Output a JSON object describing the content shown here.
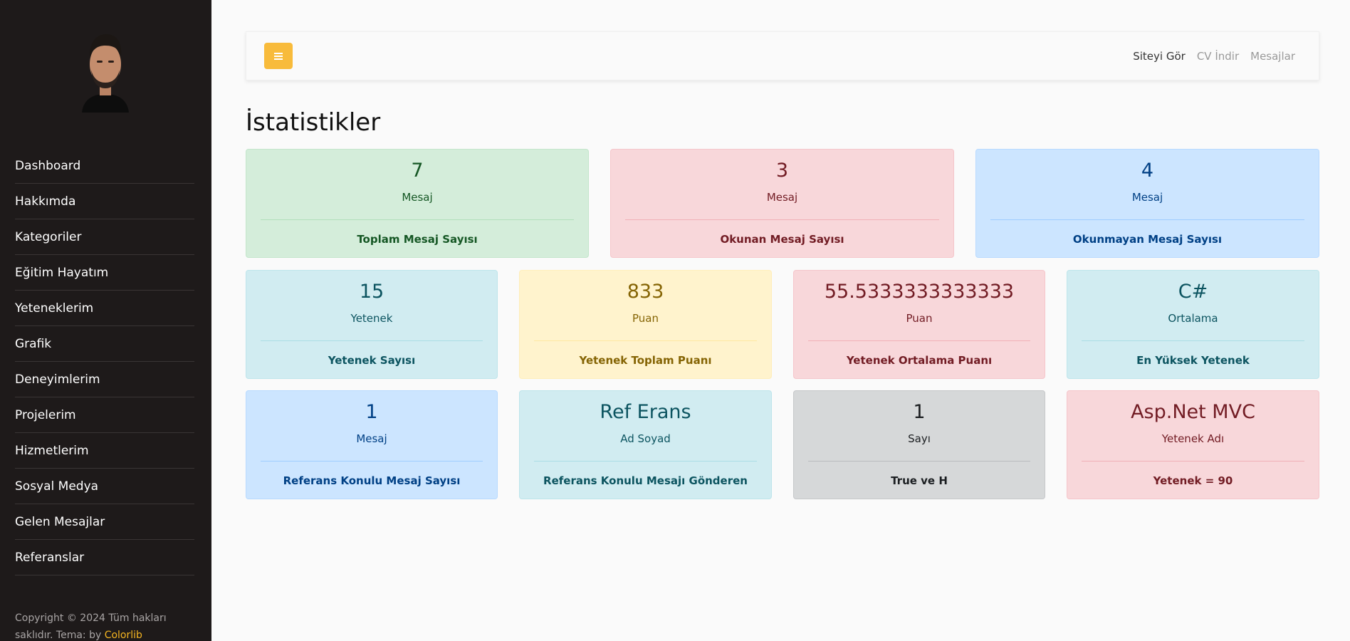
{
  "sidebar": {
    "items": [
      {
        "label": "Dashboard"
      },
      {
        "label": "Hakkımda"
      },
      {
        "label": "Kategoriler"
      },
      {
        "label": "Eğitim Hayatım"
      },
      {
        "label": "Yeteneklerim"
      },
      {
        "label": "Grafik"
      },
      {
        "label": "Deneyimlerim"
      },
      {
        "label": "Projelerim"
      },
      {
        "label": "Hizmetlerim"
      },
      {
        "label": "Sosyal Medya"
      },
      {
        "label": "Gelen Mesajlar"
      },
      {
        "label": "Referanslar"
      }
    ],
    "footer": {
      "text": "Copyright © 2024 Tüm hakları saklıdır. Tema: by",
      "link": "Colorlib"
    }
  },
  "topbar": {
    "links": [
      "Siteyi Gör",
      "CV İndir",
      "Mesajlar"
    ],
    "toggle_icon": "menu-icon",
    "toggle_color": "#f8bb3b"
  },
  "page": {
    "title": "İstatistikler"
  },
  "cards": [
    {
      "value": "7",
      "unit": "Mesaj",
      "label": "Toplam Mesaj Sayısı"
    },
    {
      "value": "3",
      "unit": "Mesaj",
      "label": "Okunan Mesaj Sayısı"
    },
    {
      "value": "4",
      "unit": "Mesaj",
      "label": "Okunmayan Mesaj Sayısı"
    },
    {
      "value": "15",
      "unit": "Yetenek",
      "label": "Yetenek Sayısı"
    },
    {
      "value": "833",
      "unit": "Puan",
      "label": "Yetenek Toplam Puanı"
    },
    {
      "value": "55.5333333333333",
      "unit": "Puan",
      "label": "Yetenek Ortalama Puanı"
    },
    {
      "value": "C#",
      "unit": "Ortalama",
      "label": "En Yüksek Yetenek"
    },
    {
      "value": "1",
      "unit": "Mesaj",
      "label": "Referans Konulu Mesaj Sayısı"
    },
    {
      "value": "Ref Erans",
      "unit": "Ad Soyad",
      "label": "Referans Konulu Mesajı Gönderen"
    },
    {
      "value": "1",
      "unit": "Sayı",
      "label": "True ve H"
    },
    {
      "value": "Asp.Net MVC",
      "unit": "Yetenek Adı",
      "label": "Yetenek = 90"
    }
  ]
}
